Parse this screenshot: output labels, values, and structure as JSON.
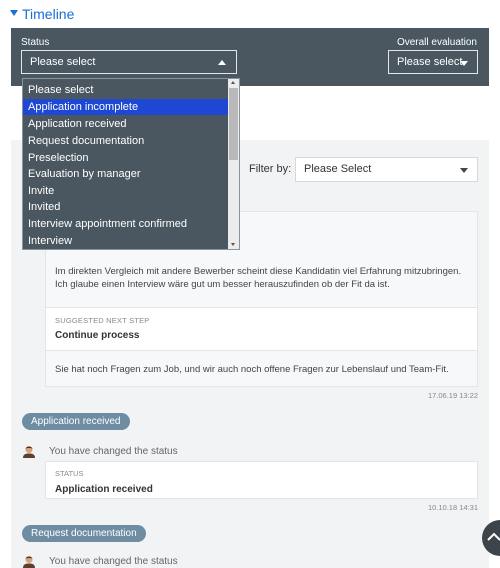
{
  "timeline": {
    "title": "Timeline"
  },
  "status_panel": {
    "status_label": "Status",
    "status_value": "Please select",
    "overall_label": "Overall evaluation",
    "overall_value": "Please select"
  },
  "status_dropdown": {
    "selected_index": 1,
    "options": [
      "Please select",
      "Application incomplete",
      "Application received",
      "Request documentation",
      "Preselection",
      "Evaluation by manager",
      "Invite",
      "Invited",
      "Interview appointment confirmed",
      "Interview"
    ]
  },
  "filter": {
    "label": "Filter by:",
    "value": "Please Select"
  },
  "entry1": {
    "comment": "Im direkten Vergleich mit andere Bewerber scheint diese Kandidatin viel Erfahrung mitzubringen. Ich glaube einen Interview wäre gut um besser herauszufinden ob der Fit da ist.",
    "suggested_label": "SUGGESTED NEXT STEP",
    "suggested_value": "Continue process",
    "comment2": "Sie hat noch Fragen zum Job, und wir auch noch offene Fragen zur Lebenslauf und Team-Fit.",
    "timestamp": "17.06.19 13:22"
  },
  "entry2": {
    "badge": "Application received",
    "changed_text": "You have changed the status",
    "status_label": "STATUS",
    "status_value": "Application received",
    "timestamp": "10.10.18 14:31"
  },
  "entry3": {
    "badge": "Request documentation",
    "changed_text": "You have changed the status"
  },
  "colors": {
    "accent": "#1a6fd4",
    "panel": "#4a5760",
    "selected": "#1e48d3",
    "badge": "#6e8ca2"
  }
}
